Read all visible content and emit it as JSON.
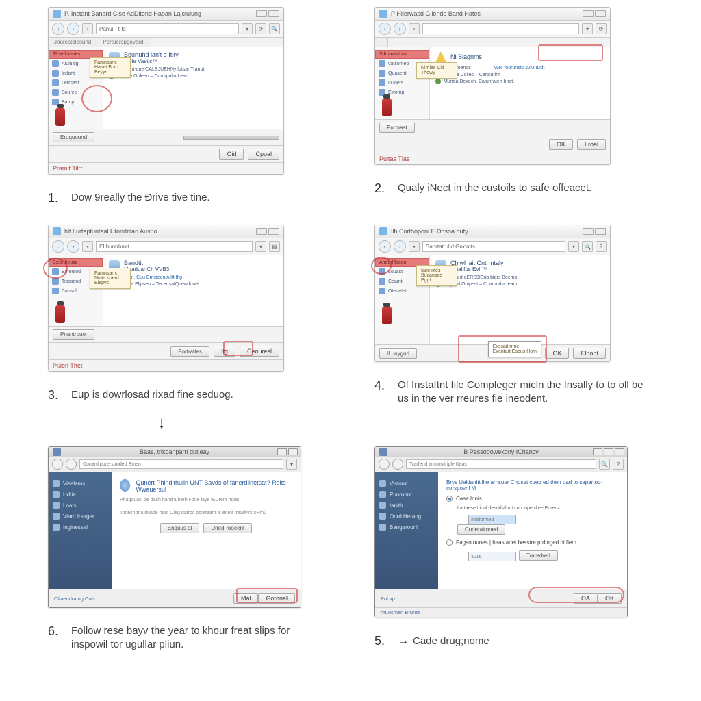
{
  "steps": {
    "s1": {
      "num": "1.",
      "text": "Dow 9really the Đrive tive tine."
    },
    "s2": {
      "num": "2.",
      "text": "Qualy iNect in the custoils to safe offeacet."
    },
    "s3": {
      "num": "3.",
      "text": "Eup is dowrlosad rixad fine seduog."
    },
    "s4": {
      "num": "4.",
      "text": "Of Instaftnt file Compleger micln the Insally to to oll be us in the ver rreures fie ineodent."
    },
    "s5": {
      "num": "5.",
      "text": "Cade drug;nome"
    },
    "s6": {
      "num": "6.",
      "text": "Follow rese bayv the year to khour freat slips for inspowil tor ugullar pliun."
    }
  },
  "panel1": {
    "title": "P. Instant Banard Cise AdDitend Hapan Lajcluiung",
    "address": "Panui - t-ts",
    "tab1": "Jourestolesund",
    "tab2": "Pertuerspgoverd",
    "side_head": "Thse lunsres",
    "side": [
      "Aiuluitig",
      "Intlant",
      "Lerrsast",
      "Sourec",
      "Bamp"
    ],
    "popup1": "Famnasne",
    "popup2": "Haset Bord",
    "popup3": "Beyys",
    "content_title": "Bourtuhd lan't d Itlry",
    "content_sub": "Ainle Vastic™",
    "content_line1": "Gesvintoent-one CALBJUEHNy lutsar Tranut",
    "content_line2": "Hanale Onleen – Comrpulio Lean.",
    "btn_left": "Eruquound",
    "btn_ok": "Oid",
    "btn_cancel": "Cpoal",
    "status": "Pramit Tilrr"
  },
  "panel2": {
    "title": "P Hilerwasd Gilende Band Hates",
    "side_head": "Sdr nrasitom",
    "side": [
      "vatsomeo",
      "Quasent",
      "Dunets",
      "Ewomp"
    ],
    "popup1": "Nimles Clti",
    "popup2": "Thowy",
    "warn_label": "Nl Slagnms",
    "content_title": "En eproends",
    "content_right": "Wer fourunsts 22M IDdt",
    "content_line1": "Lanalla Colles – Cartsurinr",
    "content_line2": "Munda Dexech. Catunraten hnet.",
    "btn_left": "Purmast",
    "btn_ok": "OK",
    "btn_cancel": "Lroal",
    "status": "Puitas Tlas"
  },
  "panel3": {
    "title": "hlt Lurtaptuntaal Utondrilan Ausno",
    "addr": "ELhuntrhmrt",
    "tab1": "",
    "side_head": "Bsse heuso",
    "side": [
      "Emersod",
      "Tibssend",
      "Cansul"
    ],
    "popup1": "Famnsarrc",
    "popup2": "Ntats suerd",
    "popup3": "Elepys",
    "content_title": "Bandtit",
    "content_sub": "MiraduanCh VVB3",
    "content_link": "Tytsartidem, Cuu Bmideen Alltt Iflg",
    "content_line": "Prendie Elipsen – TecertsalQuew luoet.",
    "btn_left": "Pnantrouol",
    "btn_mid": "Portrattes",
    "btn_ok": "Itg",
    "btn_cancel": "Ceouresl",
    "status": "Puien Thet"
  },
  "panel4": {
    "title": "Ilh Corthoponi E Dosoa outy",
    "addr": "Sanrtatrulid Grromts",
    "side_head": "Anourl focen",
    "side": [
      "Louast",
      "Ceamt",
      "Otenetet"
    ],
    "popup1": "Ianeintes",
    "popup2": "Bucansee",
    "popup3": "Egpt",
    "content_title": "Chiwl lait Cntrrntaly",
    "content_sub": "Mhalifus Evl ™",
    "content_line1": "Ganinteveed oERS9IEnb blars Beems",
    "content_line2": "Hogtnid Onipest – Coamodia team",
    "tooltip1": "Exssait rnne",
    "tooltip2": "Exentart Esbus Hom",
    "btn_left": "ILunygud",
    "btn_ok": "OK",
    "btn_cancel": "Elnont"
  },
  "installer5": {
    "title": "Baas, tnkoanparn dutleay",
    "addr": "Conard porerstroded Emen",
    "side": [
      "Visalems",
      "Hdtie",
      "Loats",
      "Viard Irsager",
      "Inginessal"
    ],
    "heading": "Qunert Phindlthulin UNT Bavds of fanerd'inetsat? Relts-Wwauersul",
    "desc1": "Phagouaci de dash hand'a herh Fone laye lEDrent mpat",
    "desc2": "Tooeshorla duade haut Oleg datroc pontteant ts enrot treallyirs sHmu",
    "btn_mid1": "Enquus al",
    "btn_mid2": "UnedPooeent",
    "btn_ok": "Mal",
    "btn_cancel": "Gotonel",
    "footer": "Citaendramg Cws"
  },
  "installer6": {
    "title": "B Pessodowekony IChancy",
    "addr": "Trarfend amonstiriple Keas",
    "side": [
      "Vistomt",
      "Punrnnnt",
      "tanith",
      "Oord Herang",
      "Bangeroonl"
    ],
    "heading": "Brys Ueldanittlihe arnsoer Choset cuep ed then dad to separtod-corspovnl M",
    "radio1_label": "Case Innis",
    "radio1_sub": "Lattaesetttionl desddstluut cun inperd ee Eorers",
    "input1": "Inddormed",
    "input_btn": "Coderaironed",
    "radio2_label": "Pagsotounes | haas adet besstre prdinged bi fiem.",
    "input2": "3016",
    "input2_btn": "Traredred",
    "btn_ok": "OA",
    "btn_cancel": "OK",
    "footer": "Pul vp",
    "footer2": "hrLocman Brunst"
  }
}
